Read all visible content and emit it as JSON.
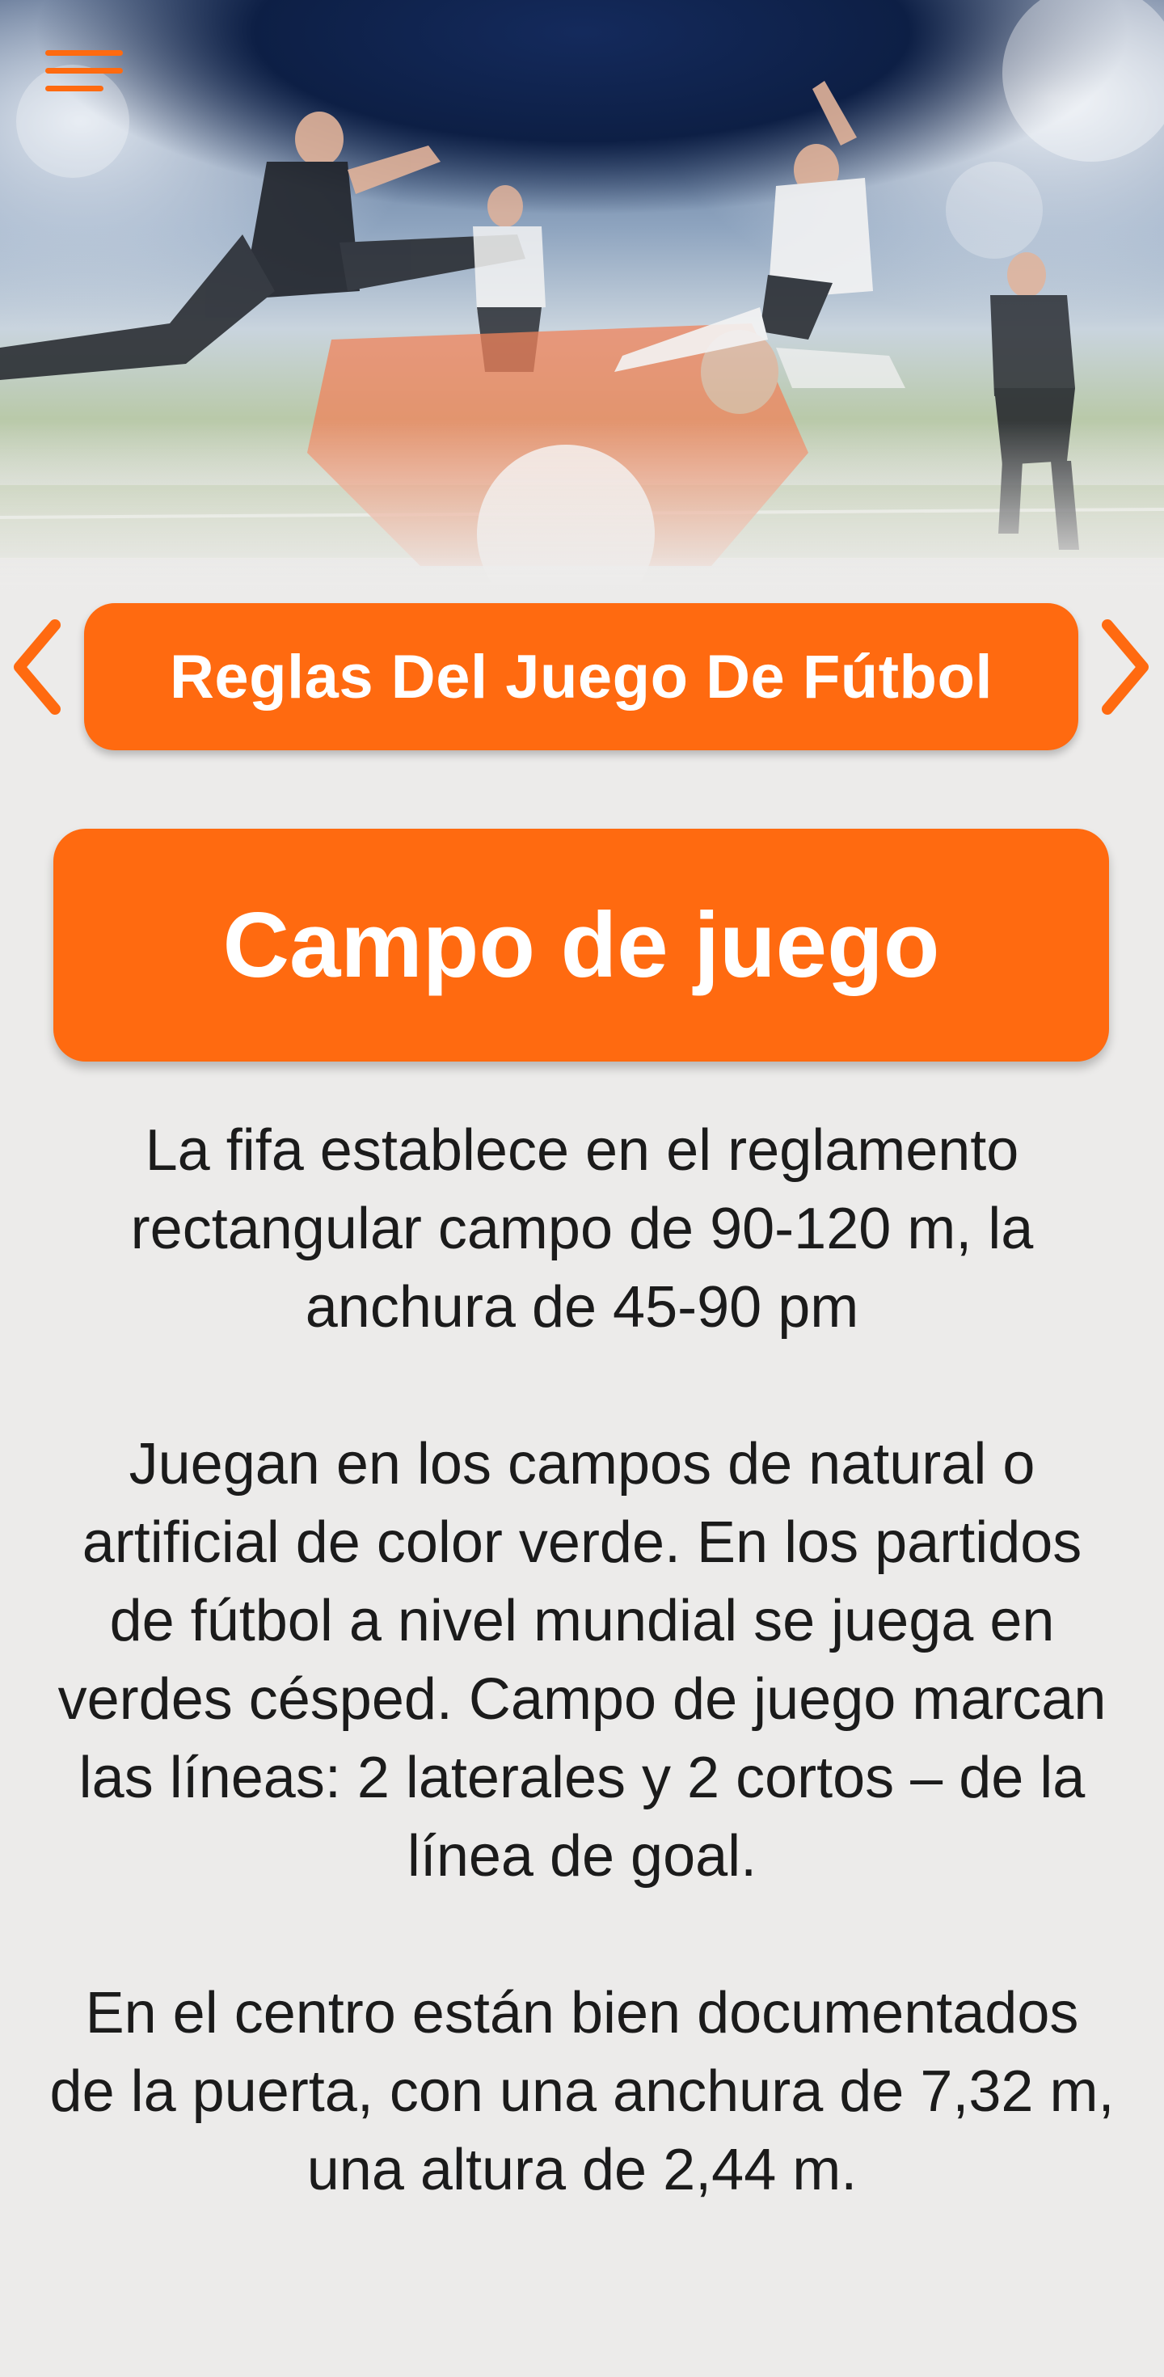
{
  "header": {
    "menu_icon": "hamburger-menu-icon",
    "prev_icon": "chevron-left-icon",
    "next_icon": "chevron-right-icon",
    "title": "Reglas Del Juego De Fútbol"
  },
  "section": {
    "title": "Campo de juego"
  },
  "content": {
    "paragraphs": [
      "La fifa establece en el reglamento rectangular campo de 90-120 m, la anchura de 45-90 pm",
      "Juegan en los campos de natural o artificial de color verde. En los partidos de fútbol a nivel mundial se juega en verdes césped. Campo de juego marcan las líneas: 2 laterales y 2 cortos – de la línea de goal.",
      "En el centro están bien documentados de la puerta, con una anchura de 7,32 m, una altura de 2,44 m."
    ]
  },
  "colors": {
    "accent": "#ff6a10",
    "background": "#ecebea",
    "text": "#1b1b1b"
  }
}
